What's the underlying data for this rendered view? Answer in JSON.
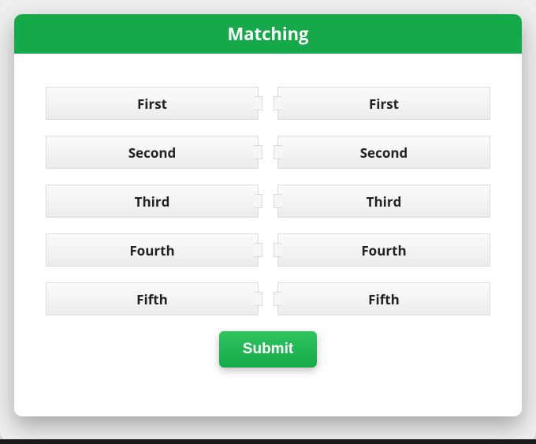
{
  "header": {
    "title": "Matching"
  },
  "pairs": {
    "left": [
      "First",
      "Second",
      "Third",
      "Fourth",
      "Fifth"
    ],
    "right": [
      "First",
      "Second",
      "Third",
      "Fourth",
      "Fifth"
    ]
  },
  "actions": {
    "submit_label": "Submit"
  },
  "colors": {
    "accent": "#16a94a"
  }
}
